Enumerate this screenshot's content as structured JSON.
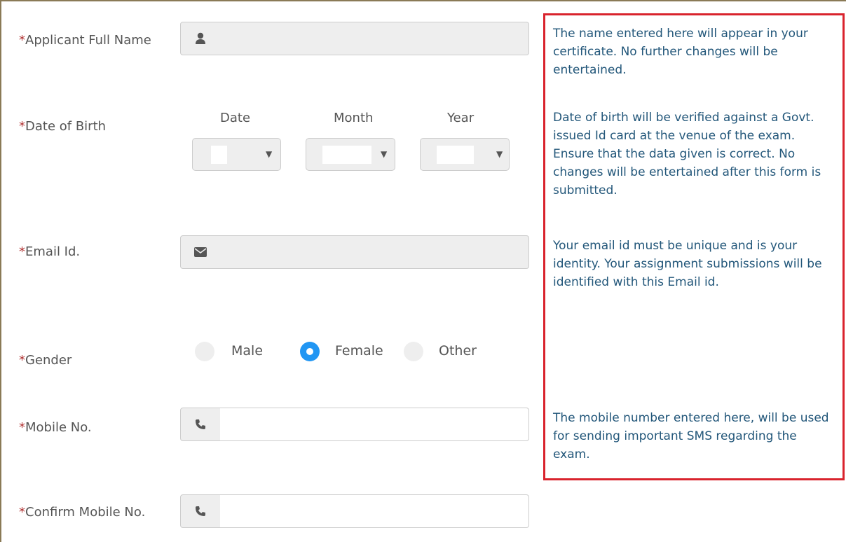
{
  "form": {
    "full_name": {
      "label": "Applicant Full Name",
      "icon": "user-icon",
      "value": ""
    },
    "dob": {
      "label": "Date of Birth",
      "headers": {
        "date": "Date",
        "month": "Month",
        "year": "Year"
      }
    },
    "email": {
      "label": "Email Id.",
      "icon": "envelope-icon",
      "value": ""
    },
    "gender": {
      "label": "Gender",
      "options": [
        "Male",
        "Female",
        "Other"
      ],
      "selected": "Female"
    },
    "mobile": {
      "label": "Mobile No.",
      "icon": "phone-icon",
      "value": ""
    },
    "confirm_mobile": {
      "label": "Confirm Mobile No.",
      "icon": "phone-icon",
      "value": ""
    }
  },
  "help": {
    "name": "The name entered here will appear in your certificate. No further changes will be entertained.",
    "dob": "Date of birth will be verified against a Govt. issued Id card at the venue of the exam. Ensure that the data given is correct. No changes will be entertained after this form is submitted.",
    "email": "Your email id must be unique and is your identity. Your assignment submissions will be identified with this Email id.",
    "mobile": "The mobile number entered here, will be used for sending important SMS regarding the exam."
  },
  "colors": {
    "required": "#b03030",
    "help_text": "#23577a",
    "help_border": "#d9232d",
    "radio_selected": "#2196f3"
  }
}
